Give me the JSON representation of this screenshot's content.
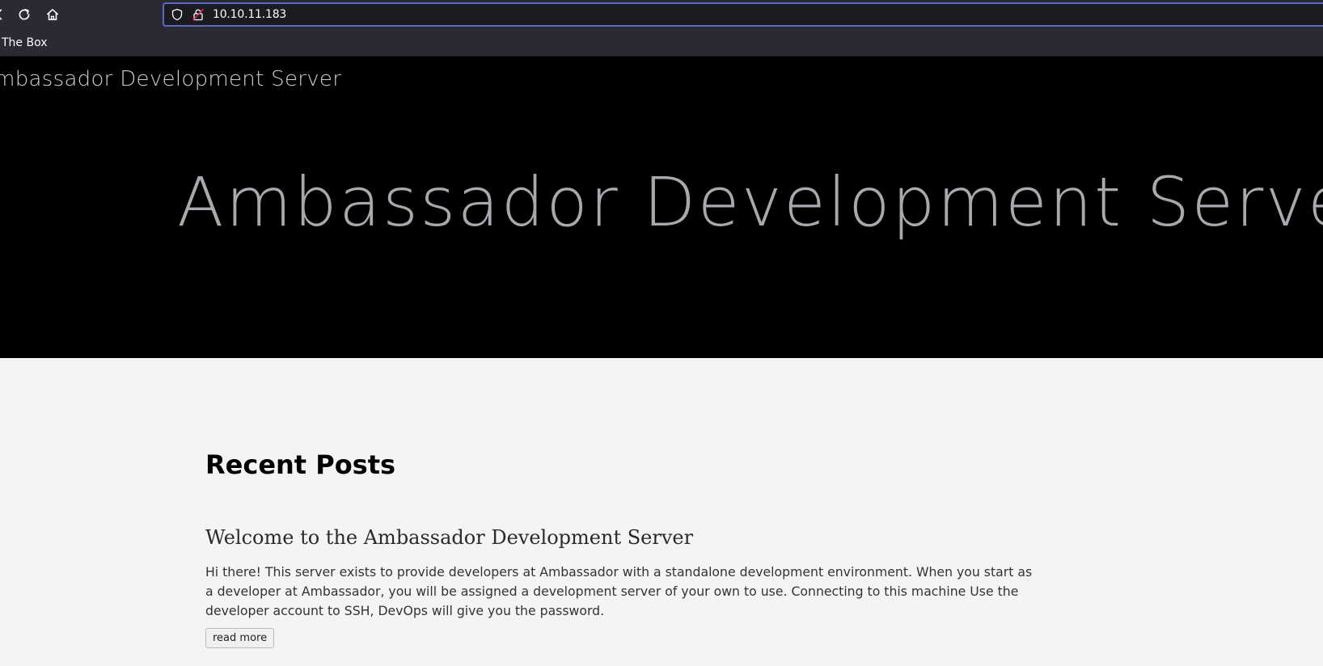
{
  "browser": {
    "url": "10.10.11.183",
    "bookmarks": [
      {
        "label": "The Box"
      }
    ],
    "icons": {
      "back": "arrow-left-icon",
      "reload": "reload-icon",
      "home": "home-icon",
      "tracking": "shield-icon",
      "security": "insecure-lock-icon"
    }
  },
  "site": {
    "brand": "Ambassador Development Server",
    "hero_title": "Ambassador Development Server"
  },
  "recent_posts": {
    "heading": "Recent Posts",
    "posts": [
      {
        "title": "Welcome to the Ambassador Development Server",
        "excerpt": "Hi there! This server exists to provide developers at Ambassador with a standalone development environment. When you start as a developer at Ambassador, you will be assigned a development server of your own to use. Connecting to this machine Use the developer account to SSH, DevOps will give you the password.",
        "read_more_label": "read more"
      }
    ]
  },
  "colors": {
    "chrome_bg": "#2b2a33",
    "urlbar_bg": "#1c1b22",
    "urlbar_focus": "#5b6bbf",
    "hero_bg": "#000000",
    "page_bg": "#f4f4f4"
  }
}
